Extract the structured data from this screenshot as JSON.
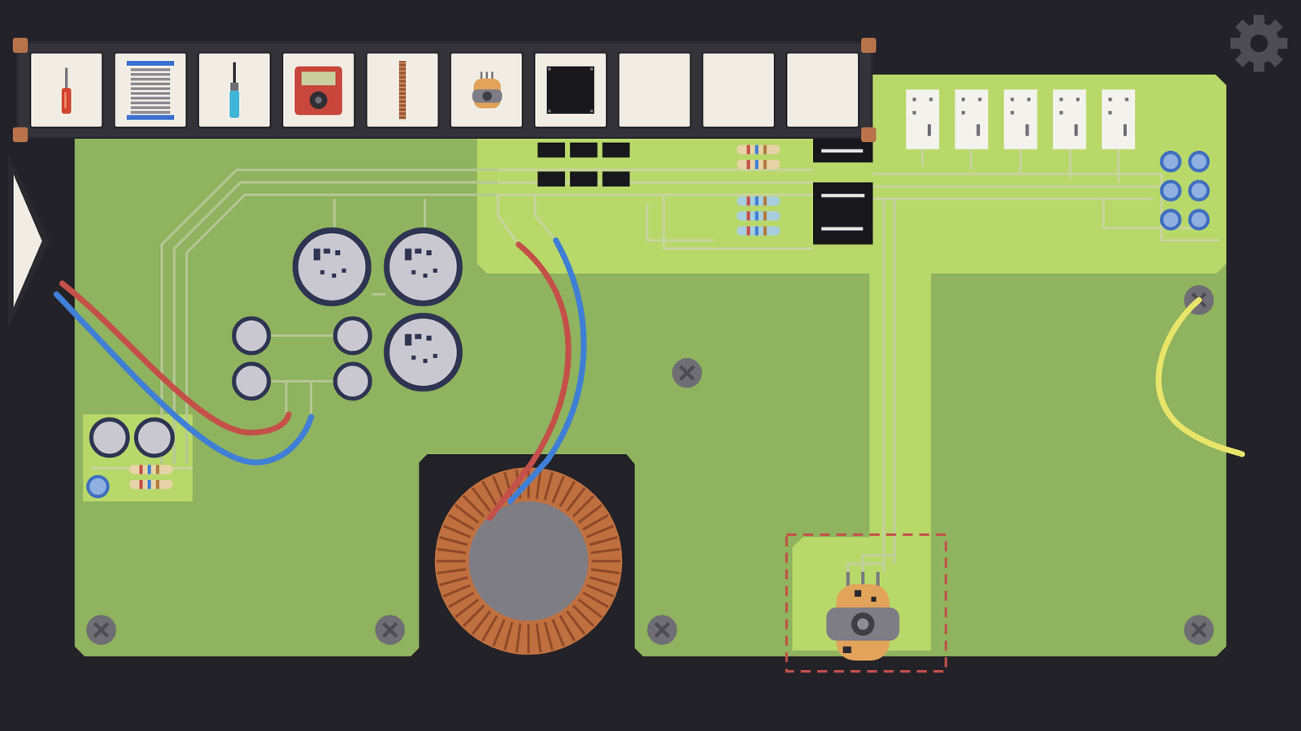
{
  "toolbar": {
    "slots": [
      {
        "kind": "screwdriver"
      },
      {
        "kind": "solder-spool"
      },
      {
        "kind": "soldering-iron"
      },
      {
        "kind": "multimeter"
      },
      {
        "kind": "wire"
      },
      {
        "kind": "potentiometer"
      },
      {
        "kind": "chip"
      },
      {
        "kind": "empty"
      },
      {
        "kind": "empty"
      },
      {
        "kind": "empty"
      }
    ]
  },
  "board": {
    "target": {
      "kind": "potentiometer",
      "highlighted": true
    },
    "wires": [
      {
        "name": "input-red",
        "color": "#c4504a"
      },
      {
        "name": "input-blue",
        "color": "#3f7fd6"
      },
      {
        "name": "transformer-red",
        "color": "#c4504a"
      },
      {
        "name": "transformer-blue",
        "color": "#3f7fd6"
      },
      {
        "name": "loose-yellow",
        "color": "#e8e56a"
      }
    ]
  }
}
